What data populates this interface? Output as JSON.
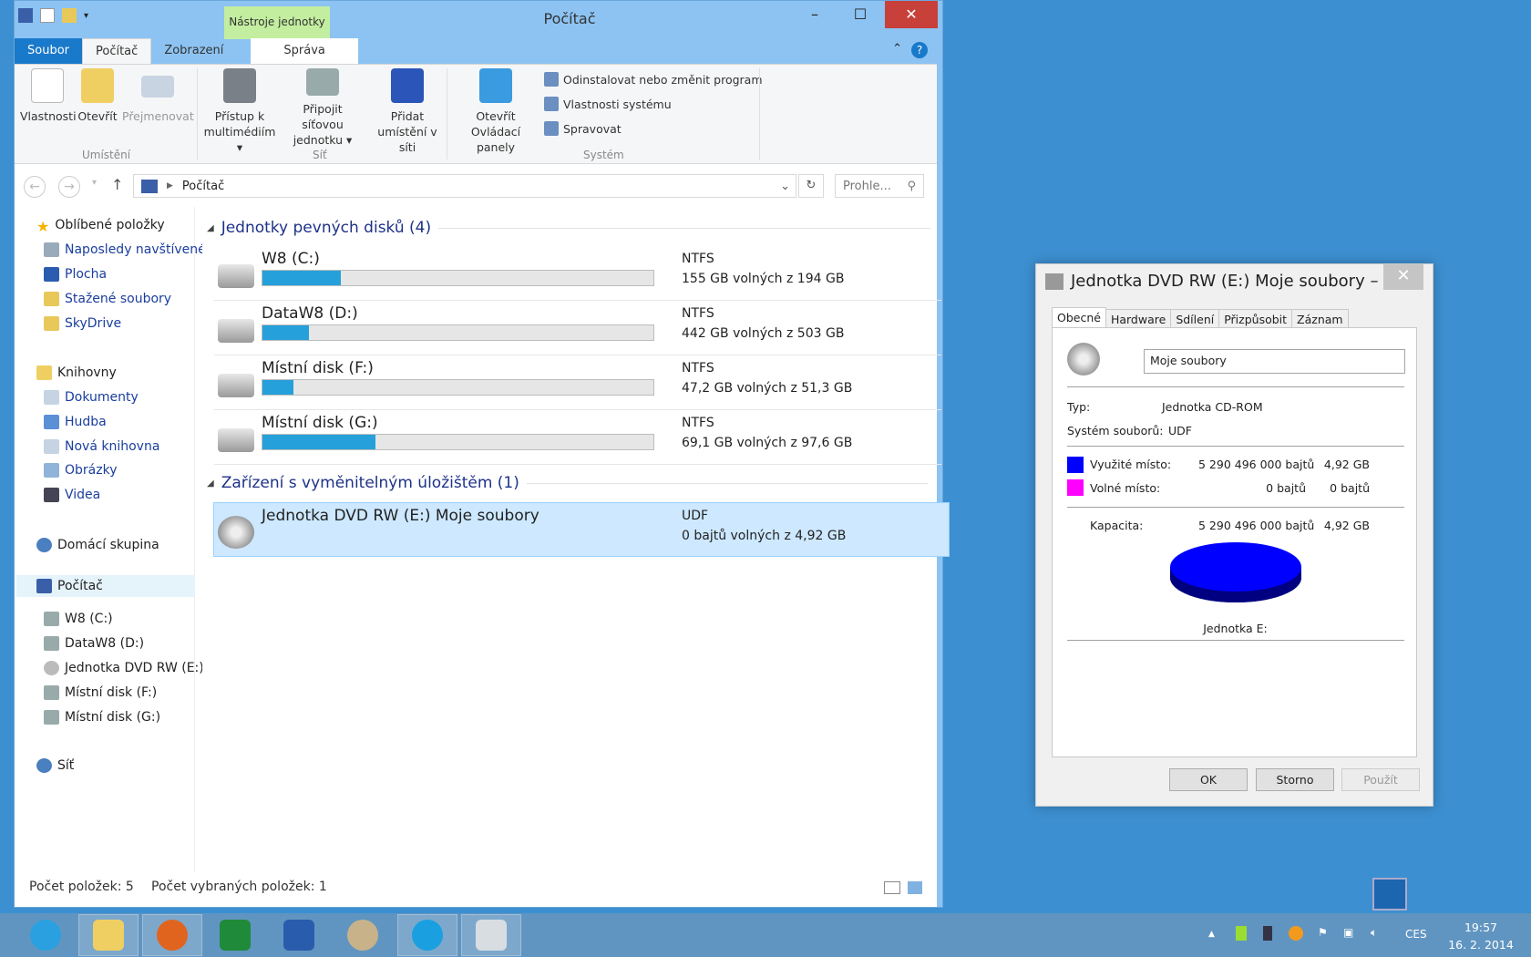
{
  "explorer": {
    "title": "Počítač",
    "contextual_tab_group": "Nástroje jednotky",
    "tabs": [
      "Soubor",
      "Počítač",
      "Zobrazení",
      "Správa"
    ],
    "ribbon": {
      "location": {
        "label": "Umístění",
        "buttons": [
          "Vlastnosti",
          "Otevřít",
          "Přejmenovat"
        ]
      },
      "network": {
        "label": "Síť",
        "buttons": [
          "Přístup k multimédiím",
          "Připojit síťovou jednotku",
          "Přidat umístění v síti"
        ]
      },
      "system": {
        "label": "Systém",
        "big_button": "Otevřít Ovládací panely",
        "small_buttons": [
          "Odinstalovat nebo změnit program",
          "Vlastnosti systému",
          "Spravovat"
        ]
      }
    },
    "address": "Počítač",
    "search_placeholder": "Prohle...",
    "nav": {
      "favorites": "Oblíbené položky",
      "favorite_items": [
        "Naposledy navštívené",
        "Plocha",
        "Stažené soubory",
        "SkyDrive"
      ],
      "libraries": "Knihovny",
      "library_items": [
        "Dokumenty",
        "Hudba",
        "Nová knihovna",
        "Obrázky",
        "Videa"
      ],
      "homegroup": "Domácí skupina",
      "computer": "Počítač",
      "computer_items": [
        "W8 (C:)",
        "DataW8 (D:)",
        "Jednotka DVD RW (E:)",
        "Místní disk (F:)",
        "Místní disk (G:)"
      ],
      "network": "Síť"
    },
    "groups": {
      "hard_drives": "Jednotky pevných disků (4)",
      "removable": "Zařízení s vyměnitelným úložištěm (1)"
    },
    "drives": [
      {
        "name": "W8 (C:)",
        "fs": "NTFS",
        "free": "155 GB volných z 194 GB",
        "used_percent": 20
      },
      {
        "name": "DataW8 (D:)",
        "fs": "NTFS",
        "free": "442 GB volných z 503 GB",
        "used_percent": 12
      },
      {
        "name": "Místní disk (F:)",
        "fs": "NTFS",
        "free": "47,2 GB volných z 51,3 GB",
        "used_percent": 8
      },
      {
        "name": "Místní disk (G:)",
        "fs": "NTFS",
        "free": "69,1 GB volných z 97,6 GB",
        "used_percent": 29
      }
    ],
    "dvd": {
      "name": "Jednotka DVD RW (E:) Moje soubory",
      "fs": "UDF",
      "free": "0 bajtů volných z 4,92 GB"
    },
    "status": {
      "count": "Počet položek: 5",
      "selected": "Počet vybraných položek: 1"
    }
  },
  "dialog": {
    "title": "Jednotka DVD RW (E:) Moje soubory – vl...",
    "tabs": [
      "Obecné",
      "Hardware",
      "Sdílení",
      "Přizpůsobit",
      "Záznam"
    ],
    "label_value": "Moje soubory",
    "type_label": "Typ:",
    "type_value": "Jednotka CD-ROM",
    "fs_label": "Systém souborů:",
    "fs_value": "UDF",
    "used_label": "Využité místo:",
    "used_bytes": "5 290 496 000 bajtů",
    "used_gb": "4,92 GB",
    "free_label": "Volné místo:",
    "free_bytes": "0 bajtů",
    "free_gb": "0 bajtů",
    "cap_label": "Kapacita:",
    "cap_bytes": "5 290 496 000 bajtů",
    "cap_gb": "4,92 GB",
    "drive_caption": "Jednotka E:",
    "buttons": {
      "ok": "OK",
      "cancel": "Storno",
      "apply": "Použít"
    },
    "colors": {
      "used": "#0000ff",
      "free": "#ff00ff"
    }
  },
  "taskbar": {
    "lang": "CES",
    "time": "19:57",
    "date": "16. 2. 2014"
  }
}
